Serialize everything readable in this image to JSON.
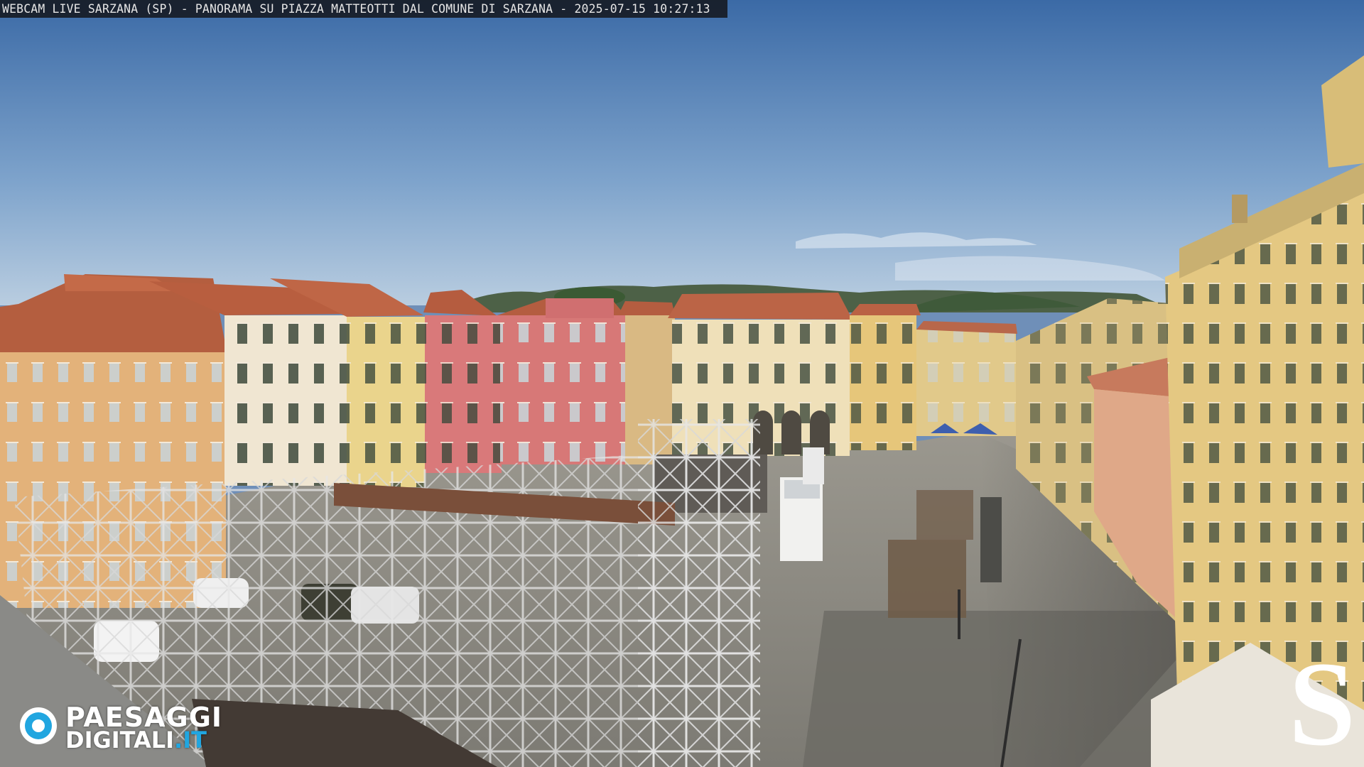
{
  "overlay": {
    "caption": "WEBCAM LIVE SARZANA (SP) - PANORAMA SU PIAZZA MATTEOTTI DAL COMUNE DI SARZANA - 2025-07-15  10:27:13"
  },
  "watermark": {
    "line1": "PAESAGGI",
    "line2_main": "DIGITALI",
    "line2_tld": ".IT",
    "corner_logo": "S"
  },
  "colors": {
    "sky_top": "#3f6ea8",
    "sky_bottom": "#a9c2dc",
    "pavement": "#8a8880",
    "pink_facade": "#d9797a",
    "yellow_facade": "#e0c98a",
    "ochre_facade": "#e3b27a",
    "roof_tiles": "#b65c3e",
    "brand_blue": "#21a6e0"
  }
}
